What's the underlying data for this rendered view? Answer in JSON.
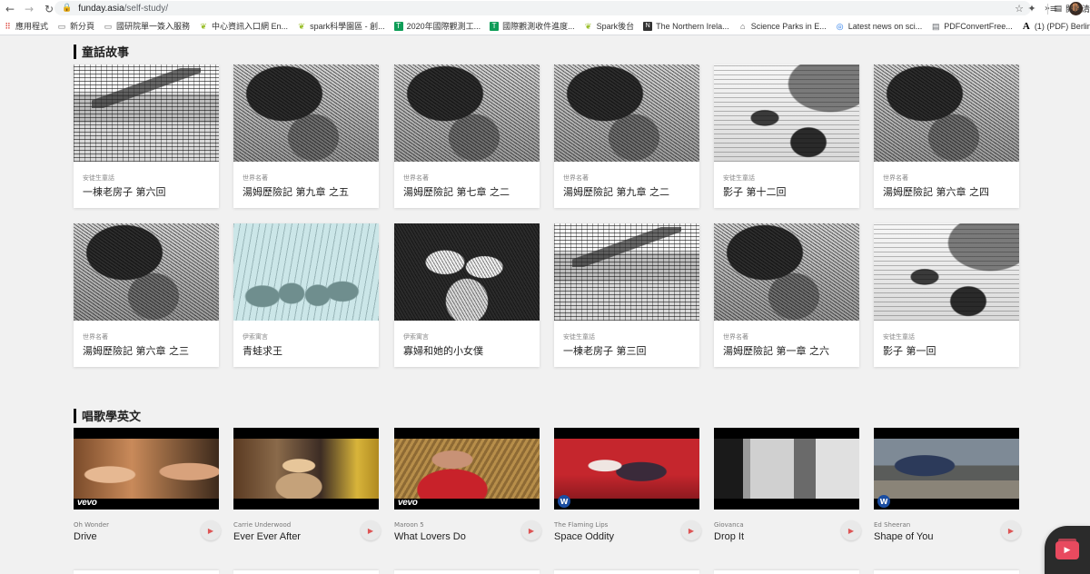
{
  "browser": {
    "url_host": "funday.asia",
    "url_path": "/self-study/",
    "bookmarks": [
      {
        "icon": "apps-icon",
        "label": "應用程式"
      },
      {
        "icon": "doc-icon",
        "label": "新分頁"
      },
      {
        "icon": "doc-icon",
        "label": "國研院單一簽入服務"
      },
      {
        "icon": "leaf-icon",
        "label": "中心資訊入口網 En..."
      },
      {
        "icon": "leaf-icon",
        "label": "spark科學園區 - 創..."
      },
      {
        "icon": "sheet-icon",
        "label": "2020年國際觀測工..."
      },
      {
        "icon": "sheet-icon",
        "label": "國際觀測收件進度..."
      },
      {
        "icon": "leaf-icon",
        "label": "Spark後台"
      },
      {
        "icon": "news-icon",
        "label": "The Northern Irela..."
      },
      {
        "icon": "bank-icon",
        "label": "Science Parks in E..."
      },
      {
        "icon": "globe-icon",
        "label": "Latest news on sci..."
      },
      {
        "icon": "pdf-icon",
        "label": "PDFConvertFree..."
      },
      {
        "icon": "A-icon",
        "label": "(1) (PDF) Berlin-Ad..."
      }
    ],
    "more": "»",
    "reading_list": "閱讀清"
  },
  "stories": {
    "title": "童話故事",
    "cards": [
      {
        "category": "安徒生童話",
        "title": "一棟老房子 第六回",
        "thumb": "house"
      },
      {
        "category": "世界名著",
        "title": "湯姆歷險記 第九章 之五",
        "thumb": "boy"
      },
      {
        "category": "世界名著",
        "title": "湯姆歷險記 第七章 之二",
        "thumb": "boy"
      },
      {
        "category": "世界名著",
        "title": "湯姆歷險記 第九章 之二",
        "thumb": "boy"
      },
      {
        "category": "安徒生童話",
        "title": "影子 第十二回",
        "thumb": "man"
      },
      {
        "category": "世界名著",
        "title": "湯姆歷險記 第六章 之四",
        "thumb": "boy"
      },
      {
        "category": "世界名著",
        "title": "湯姆歷險記 第六章 之三",
        "thumb": "boy"
      },
      {
        "category": "伊索寓言",
        "title": "青蛙求王",
        "thumb": "frogs"
      },
      {
        "category": "伊索寓言",
        "title": "寡婦和她的小女僕",
        "thumb": "women"
      },
      {
        "category": "安徒生童話",
        "title": "一棟老房子 第三回",
        "thumb": "house"
      },
      {
        "category": "世界名著",
        "title": "湯姆歷險記 第一章 之六",
        "thumb": "boy"
      },
      {
        "category": "安徒生童話",
        "title": "影子 第一回",
        "thumb": "man"
      }
    ]
  },
  "songs": {
    "title": "唱歌學英文",
    "cards": [
      {
        "artist": "Oh Wonder",
        "song": "Drive",
        "badge": "vevo"
      },
      {
        "artist": "Carrie Underwood",
        "song": "Ever Ever After",
        "badge": ""
      },
      {
        "artist": "Maroon 5",
        "song": "What Lovers Do",
        "badge": "vevo"
      },
      {
        "artist": "The Flaming Lips",
        "song": "Space Oddity",
        "badge": "w"
      },
      {
        "artist": "Giovanca",
        "song": "Drop It",
        "badge": ""
      },
      {
        "artist": "Ed Sheeran",
        "song": "Shape of You",
        "badge": "w"
      }
    ]
  },
  "badges": {
    "vevo": "vevo",
    "w": "W"
  },
  "icons": {
    "play": "play-icon",
    "fab": "video-player-icon"
  },
  "colors": {
    "accent": "#e84a5f",
    "page_bg": "#f1f1f1"
  }
}
